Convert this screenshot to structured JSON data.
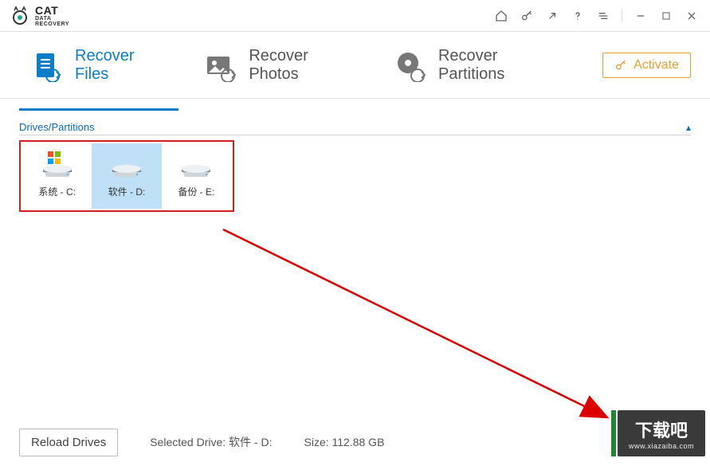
{
  "app": {
    "brand_main": "CAT",
    "brand_sub": "DATA\nRECOVERY"
  },
  "tabs": {
    "files": {
      "label": "Recover Files"
    },
    "photos": {
      "label": "Recover Photos"
    },
    "partitions": {
      "label": "Recover Partitions"
    }
  },
  "activate": {
    "label": "Activate"
  },
  "section": {
    "title": "Drives/Partitions"
  },
  "drives": [
    {
      "label": "系统 - C:",
      "is_os": true,
      "selected": false
    },
    {
      "label": "软件 - D:",
      "is_os": false,
      "selected": true
    },
    {
      "label": "备份 - E:",
      "is_os": false,
      "selected": false
    }
  ],
  "footer": {
    "reload": "Reload Drives",
    "selected_prefix": "Selected Drive: ",
    "selected_value": "软件 - D:",
    "size_prefix": "Size: ",
    "size_value": "112.88 GB"
  },
  "watermark": {
    "big": "下载吧",
    "small": "www.xiazaiba.com"
  }
}
